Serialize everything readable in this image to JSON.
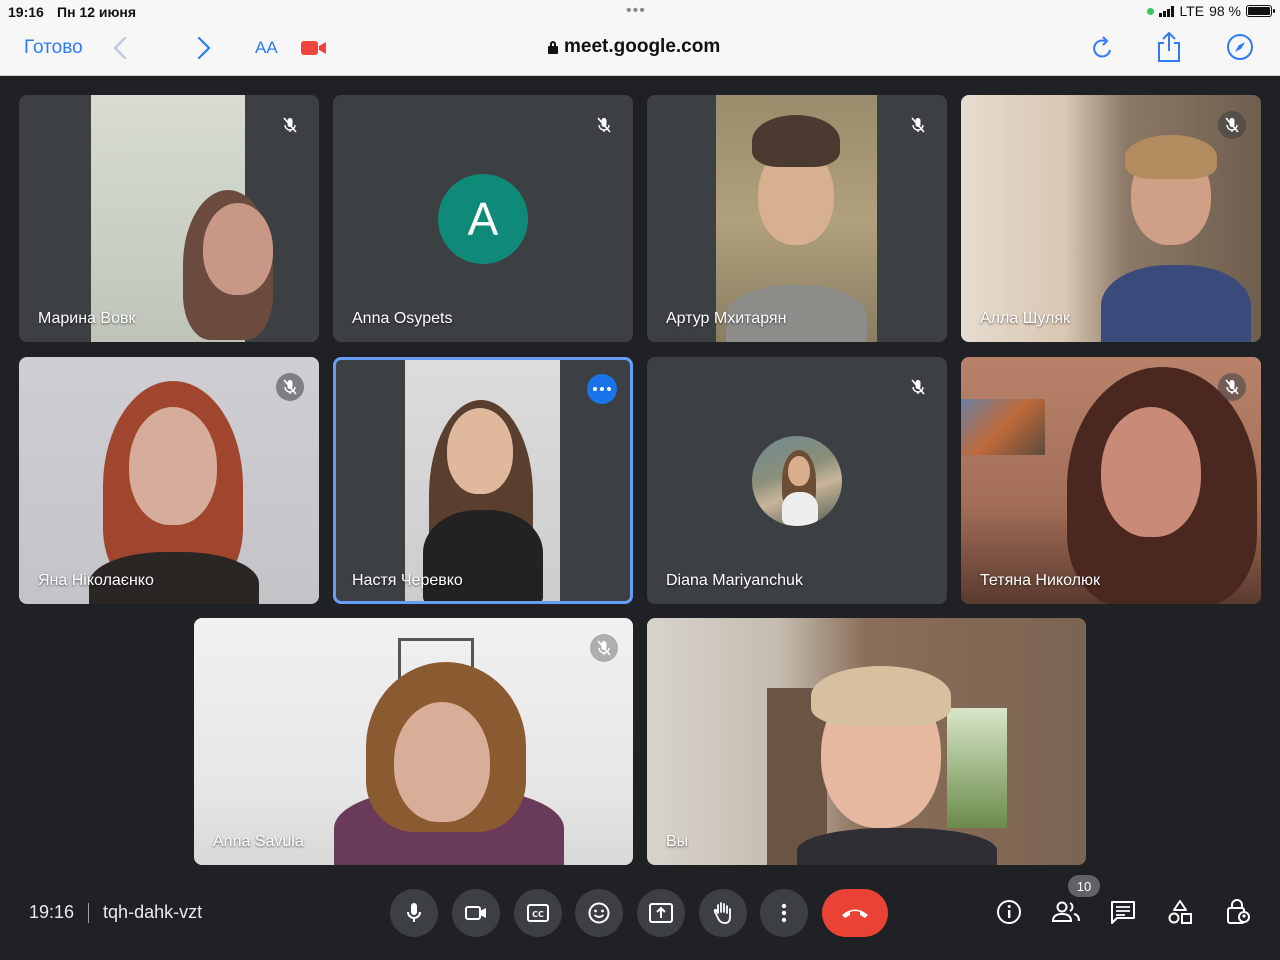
{
  "status_bar": {
    "time": "19:16",
    "date": "Пн 12 июня",
    "network": "LTE",
    "battery": "98 %",
    "battery_level": 0.98
  },
  "browser": {
    "done_label": "Готово",
    "text_size_label": "AA",
    "url": "meet.google.com"
  },
  "participants": [
    {
      "name": "Марина Вовк",
      "muted": true
    },
    {
      "name": "Anna Osypets",
      "muted": true,
      "avatar_letter": "A"
    },
    {
      "name": "Артур Мхитарян",
      "muted": true
    },
    {
      "name": "Алла Шуляк",
      "muted": true
    },
    {
      "name": "Яна Ніколаєнко",
      "muted": true
    },
    {
      "name": "Настя Черевко",
      "active_speaker": true
    },
    {
      "name": "Diana Mariyanchuk",
      "muted": true
    },
    {
      "name": "Тетяна Николюк",
      "muted": true
    },
    {
      "name": "Anna Savula",
      "muted": true
    },
    {
      "name": "Вы"
    }
  ],
  "meeting": {
    "time": "19:16",
    "code": "tqh-dahk-vzt",
    "participant_count": "10"
  },
  "colors": {
    "background": "#202124",
    "tile": "#3c4043",
    "accent": "#1a73e8",
    "end_call": "#ea4335",
    "avatar": "#0f8a79",
    "safari_blue": "#2f7bf6"
  }
}
